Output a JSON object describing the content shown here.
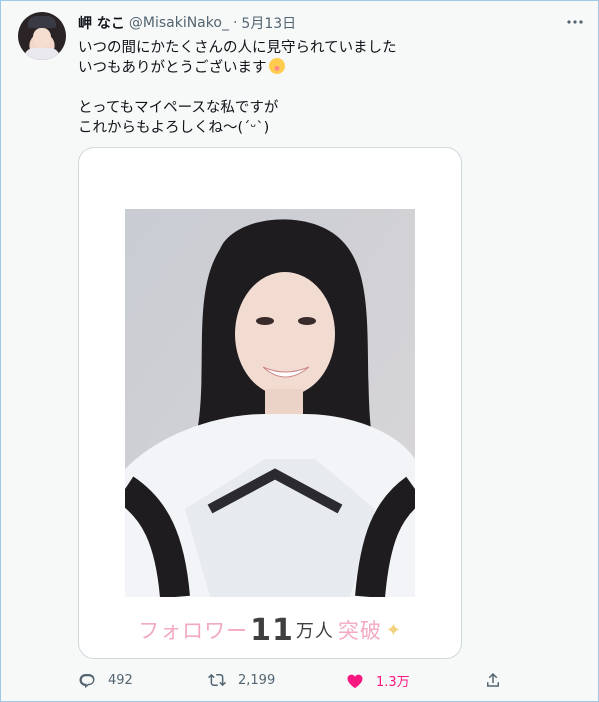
{
  "author": {
    "display_name": "岬 なこ",
    "handle": "@MisakiNako_",
    "separator": "·",
    "date": "5月13日"
  },
  "tweet": {
    "line1": "いつの間にかたくさんの人に見守られていました",
    "line2": "いつもありがとうございます",
    "line3": "とってもマイペースな私ですが",
    "line4": "これからもよろしくね〜(´ᵕ`)"
  },
  "image_caption": {
    "part_a": "フォロワー",
    "number": "11",
    "part_b": "万人",
    "part_c": "突破"
  },
  "actions": {
    "replies": "492",
    "retweets": "2,199",
    "likes": "1.3万"
  },
  "colors": {
    "like_active": "#f91880",
    "secondary_text": "#536471",
    "border": "#cfd9de"
  },
  "icons": [
    "more-options-icon",
    "reply-icon",
    "retweet-icon",
    "heart-icon",
    "share-icon",
    "smiling-emoji-icon",
    "sparkle-icon"
  ]
}
